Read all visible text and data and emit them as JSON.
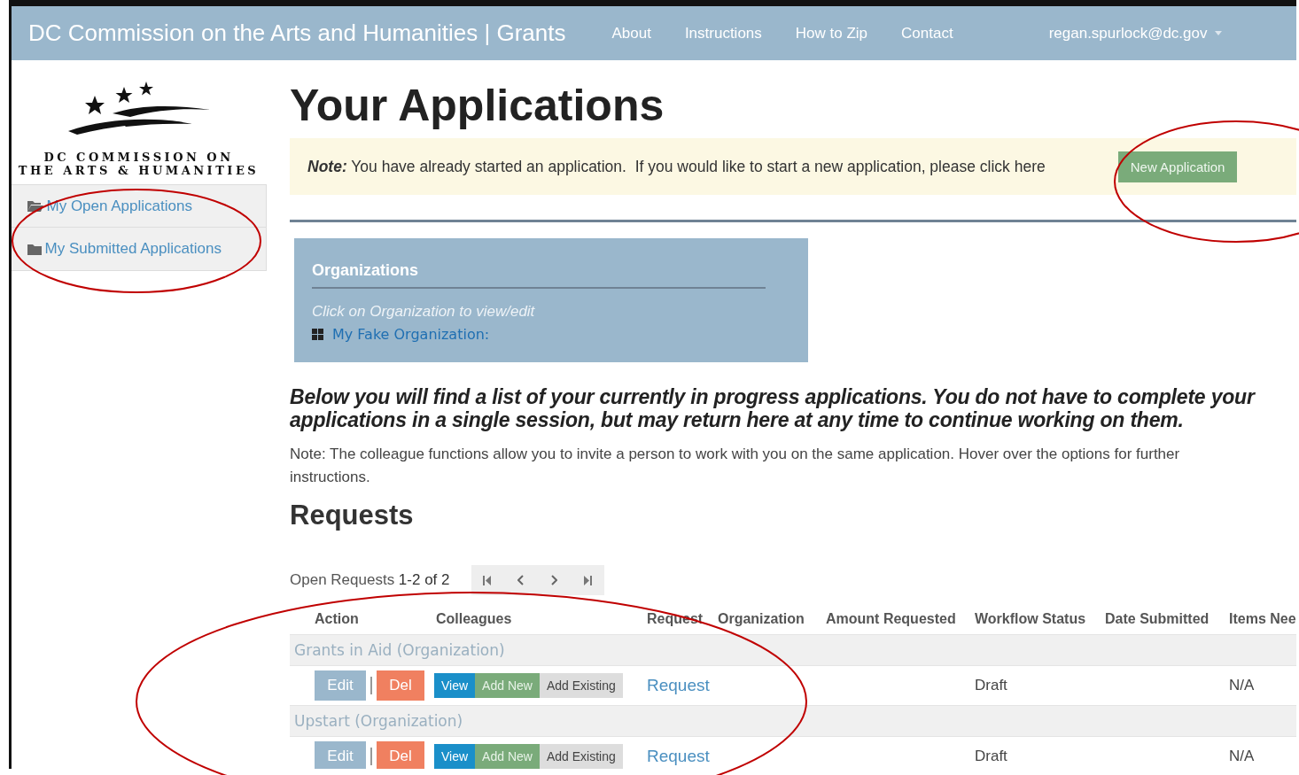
{
  "navbar": {
    "brand": "DC Commission on the Arts and Humanities | Grants",
    "links": [
      "About",
      "Instructions",
      "How to Zip",
      "Contact"
    ],
    "user": "regan.spurlock@dc.gov"
  },
  "sidebar": {
    "logo_lines": [
      "DC COMMISSION ON",
      "THE ARTS & HUMANITIES"
    ],
    "items": [
      {
        "label": "My Open Applications",
        "kind": "open",
        "selected": false
      },
      {
        "label": "My Submitted Applications",
        "kind": "closed",
        "selected": false
      }
    ]
  },
  "page_title": "Your Applications",
  "notice": {
    "lead": "Note:",
    "text": "You have already started an application.  If you would like to start a new application, please click here",
    "button": "New Application"
  },
  "organizations": {
    "title": "Organizations",
    "hint": "Click on Organization to view/edit",
    "items": [
      "My Fake Organization:"
    ]
  },
  "intro": [
    "Below you will find a list of your currently in progress applications. You do not have to complete your",
    "applications in a single session, but may return here at any time to continue working on them."
  ],
  "colleague_note": "Note: The colleague functions allow you to invite a person to work with you on the same application. Hover over the options for further instructions.",
  "requests": {
    "title": "Requests",
    "pager_label": "Open Requests",
    "pager_range": "1-2 of 2",
    "columns": [
      "Action",
      "Colleagues",
      "Request",
      "Organization",
      "Amount Requested",
      "Workflow Status",
      "Date Submitted",
      "Items Nee"
    ],
    "groups": [
      {
        "name": "Grants in Aid (Organization)",
        "rows": [
          {
            "edit": "Edit",
            "delete": "Del",
            "view": "View",
            "add_new": "Add New",
            "add_existing": "Add Existing",
            "request": "Request",
            "workflow_status": "Draft",
            "items_needed": "N/A"
          }
        ]
      },
      {
        "name": "Upstart (Organization)",
        "rows": [
          {
            "edit": "Edit",
            "delete": "Del",
            "view": "View",
            "add_new": "Add New",
            "add_existing": "Add Existing",
            "request": "Request",
            "workflow_status": "Draft",
            "items_needed": "N/A"
          }
        ]
      }
    ]
  }
}
